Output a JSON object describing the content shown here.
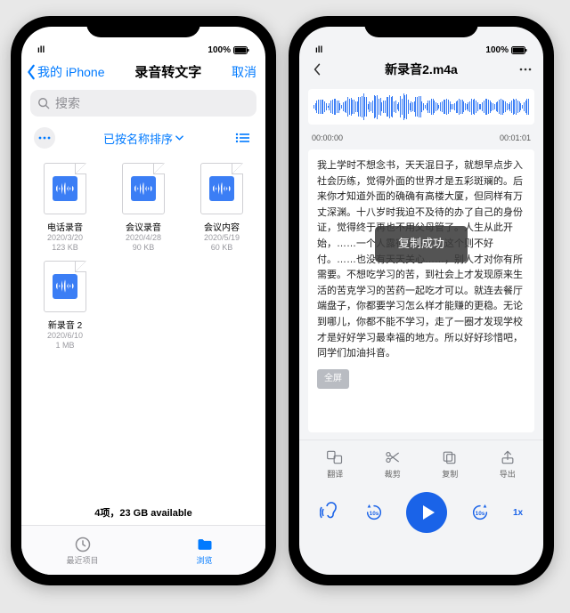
{
  "status": {
    "signal": "ıll",
    "wifi": "⬩",
    "battery_pct": "100%"
  },
  "left": {
    "back_label": "我的 iPhone",
    "title": "录音转文字",
    "cancel": "取消",
    "search_placeholder": "搜索",
    "sort_label": "已按名称排序",
    "files": [
      {
        "name": "电话录音",
        "date": "2020/3/20",
        "size": "123 KB"
      },
      {
        "name": "会议录音",
        "date": "2020/4/28",
        "size": "90 KB"
      },
      {
        "name": "会议内容",
        "date": "2020/5/19",
        "size": "60 KB"
      },
      {
        "name": "新录音 2",
        "date": "2020/6/10",
        "size": "1 MB"
      }
    ],
    "footer_status": "4项，23 GB available",
    "tabs": {
      "recent": "最近项目",
      "browse": "浏览"
    }
  },
  "right": {
    "title": "新录音2.m4a",
    "time_start": "00:00:00",
    "time_end": "00:01:01",
    "transcript": "我上学时不想念书，天天混日子，就想早点步入社会历练，觉得外面的世界才是五彩斑斓的。后来你才知道外面的确确有高楼大厦，但同样有万丈深渊。十八岁时我迫不及待的办了自己的身份证，觉得终于再也不用父母管了。人生从此开始，……一个人露宿街头……这个则不好付。……也没有天天关心……，别人才对你有所需要。不想吃学习的苦，到社会上才发现原来生活的苦克学习的苦药一起吃才可以。就连去餐厅端盘子，你都要学习怎么样才能赚的更稳。无论到哪儿，你都不能不学习，走了一圈才发现学校才是好好学习最幸福的地方。所以好好珍惜吧，同学们加油抖音。",
    "toast": "复制成功",
    "fullscreen": "全屏",
    "actions": {
      "translate": "翻译",
      "trim": "裁剪",
      "copy": "复制",
      "export": "导出"
    },
    "speed": "1x",
    "skip_back": "10s",
    "skip_fwd": "10s"
  }
}
